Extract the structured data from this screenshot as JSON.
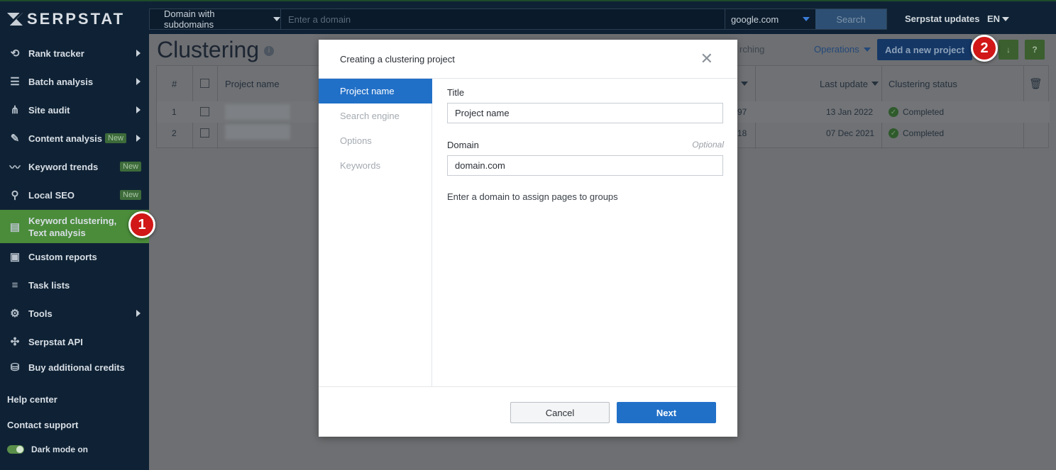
{
  "header": {
    "logo_text": "SERPSTAT",
    "domain_mode": "Domain with subdomains",
    "domain_placeholder": "Enter a domain",
    "search_engine": "google.com",
    "search_button": "Search",
    "updates_link": "Serpstat updates",
    "language": "EN"
  },
  "sidebar": {
    "items": [
      {
        "label": "Rank tracker",
        "icon": "history-icon"
      },
      {
        "label": "Batch analysis",
        "icon": "database-icon"
      },
      {
        "label": "Site audit",
        "icon": "sitemap-icon"
      },
      {
        "label": "Content analysis",
        "icon": "pencil-icon",
        "badge": "New"
      },
      {
        "label": "Keyword trends",
        "icon": "trend-icon",
        "badge": "New"
      },
      {
        "label": "Local SEO",
        "icon": "map-pin-icon",
        "badge": "New"
      },
      {
        "label": "Keyword clustering, Text analysis",
        "icon": "clustering-icon",
        "active": true
      },
      {
        "label": "Custom reports",
        "icon": "report-icon"
      },
      {
        "label": "Task lists",
        "icon": "list-icon"
      },
      {
        "label": "Tools",
        "icon": "gear-icon"
      },
      {
        "label": "Serpstat API",
        "icon": "api-icon"
      },
      {
        "label": "Buy additional credits",
        "icon": "credits-icon"
      }
    ],
    "help_center": "Help center",
    "contact_support": "Contact support",
    "dark_mode": "Dark mode on"
  },
  "main": {
    "title": "Clustering",
    "info": "i",
    "searching": "rching",
    "operations": "Operations",
    "add_project": "Add a new project",
    "export_btn": "↓",
    "help_btn": "?",
    "table": {
      "headers": {
        "num": "#",
        "name": "Project name",
        "last_update": "Last update",
        "status": "Clustering status"
      },
      "rows": [
        {
          "num": "1",
          "partial": "97",
          "last_update": "13 Jan 2022",
          "status": "Completed"
        },
        {
          "num": "2",
          "partial": "18",
          "last_update": "07 Dec 2021",
          "status": "Completed"
        }
      ]
    }
  },
  "modal": {
    "title": "Creating a clustering project",
    "close": "✕",
    "steps": [
      "Project name",
      "Search engine",
      "Options",
      "Keywords"
    ],
    "title_label": "Title",
    "title_value": "Project name",
    "domain_label": "Domain",
    "domain_optional": "Optional",
    "domain_value": "domain.com",
    "hint": "Enter a domain to assign pages to groups",
    "cancel": "Cancel",
    "next": "Next"
  },
  "callouts": [
    "1",
    "2"
  ],
  "colors": {
    "accent": "#2170c8",
    "active_nav": "#4a8c3a",
    "callout": "#d11717"
  }
}
